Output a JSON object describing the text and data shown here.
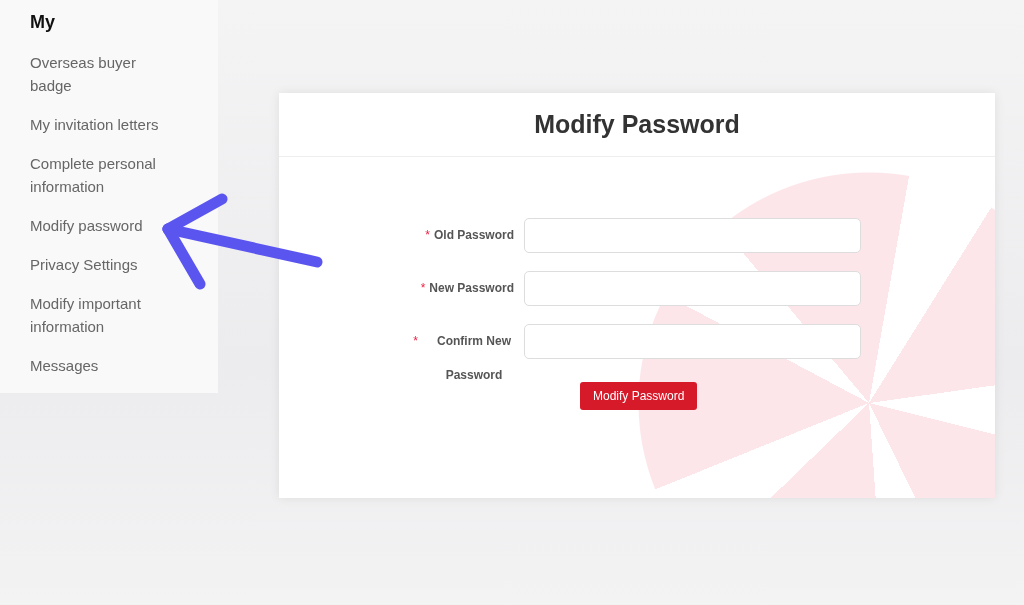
{
  "sidebar": {
    "title": "My",
    "items": [
      {
        "label": "Overseas buyer badge"
      },
      {
        "label": "My invitation letters"
      },
      {
        "label": "Complete personal information"
      },
      {
        "label": "Modify password"
      },
      {
        "label": "Privacy Settings"
      },
      {
        "label": "Modify important information"
      },
      {
        "label": "Messages"
      }
    ]
  },
  "form": {
    "title": "Modify Password",
    "fields": [
      {
        "label": "Old Password",
        "required": true,
        "marker": "*"
      },
      {
        "label": "New Password",
        "required": true,
        "marker": "*"
      },
      {
        "label": "Confirm New Password",
        "required": true,
        "marker": "*"
      }
    ],
    "submit": "Modify Password"
  }
}
